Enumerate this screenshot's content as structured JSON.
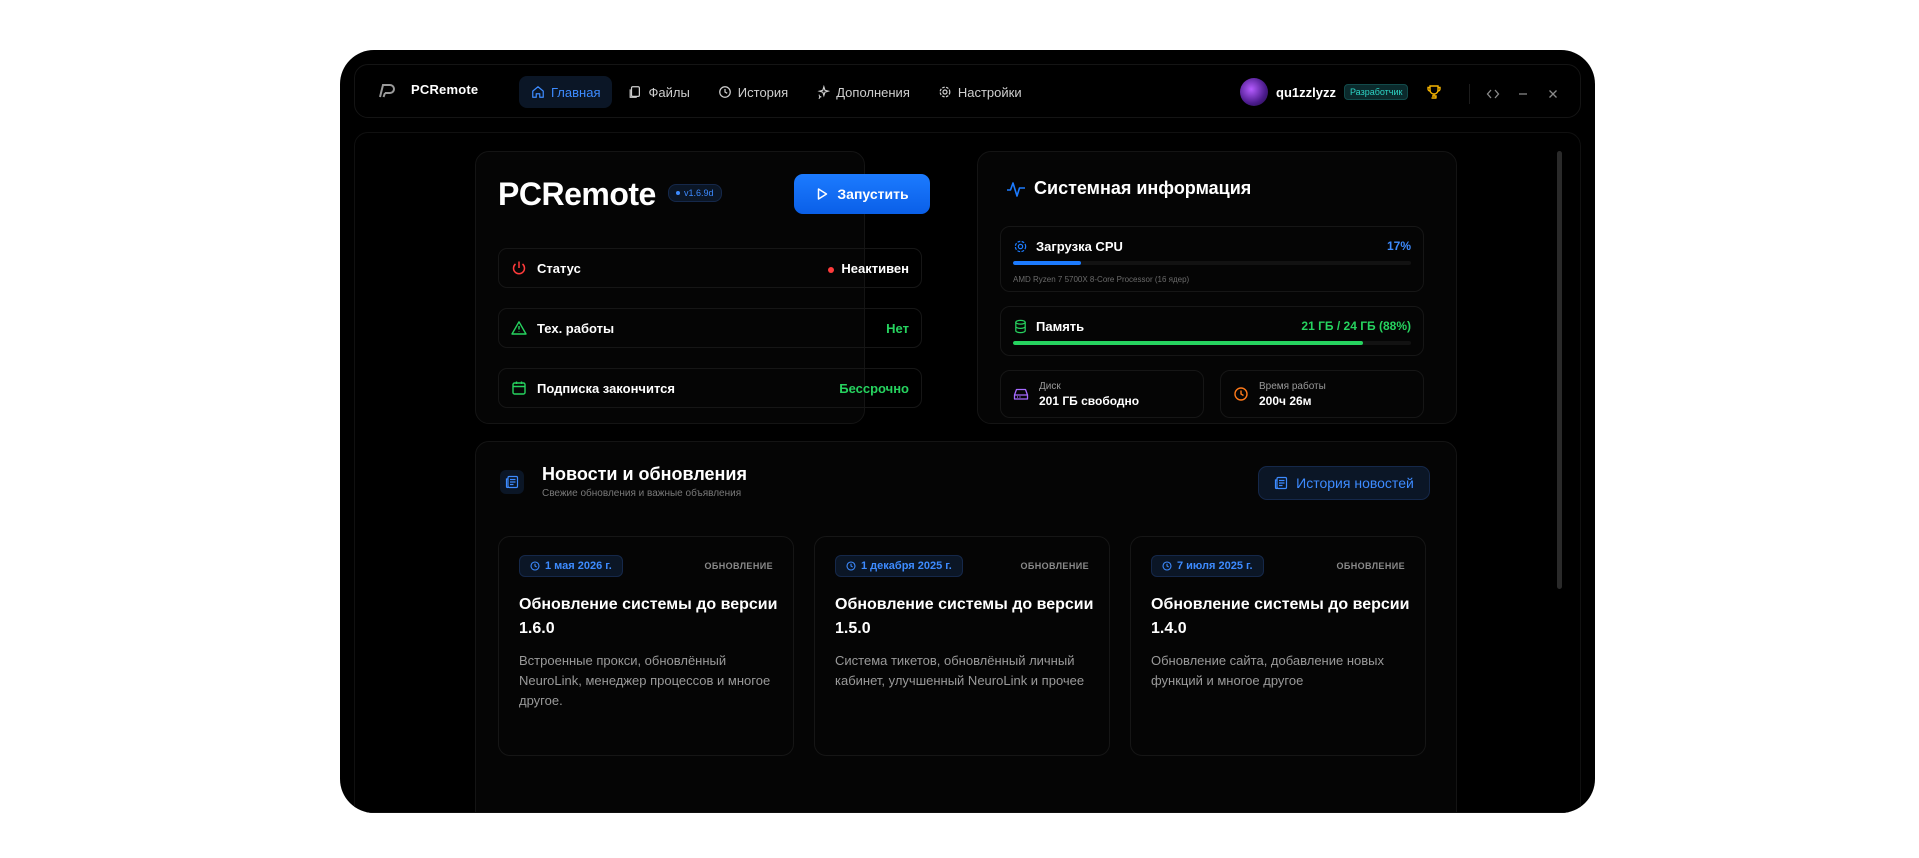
{
  "app": {
    "name": "PCRemote"
  },
  "nav": [
    {
      "label": "Главная",
      "icon": "home-icon",
      "active": true
    },
    {
      "label": "Файлы",
      "icon": "files-icon",
      "active": false
    },
    {
      "label": "История",
      "icon": "history-icon",
      "active": false
    },
    {
      "label": "Дополнения",
      "icon": "sparkles-icon",
      "active": false
    },
    {
      "label": "Настройки",
      "icon": "gear-icon",
      "active": false
    }
  ],
  "user": {
    "name": "qu1zzlyzz",
    "role": "Разработчик"
  },
  "hero": {
    "title": "PCRemote",
    "version": "v1.6.9d",
    "launch_label": "Запустить",
    "rows": [
      {
        "label": "Статус",
        "value": "Неактивен"
      },
      {
        "label": "Тех. работы",
        "value": "Нет"
      },
      {
        "label": "Подписка закончится",
        "value": "Бессрочно"
      }
    ]
  },
  "system": {
    "title": "Системная информация",
    "cpu": {
      "label": "Загрузка CPU",
      "value": "17%",
      "percent": 17,
      "model": "AMD Ryzen 7 5700X 8-Core Processor (16 ядер)"
    },
    "memory": {
      "label": "Память",
      "value": "21 ГБ / 24 ГБ (88%)",
      "percent": 88
    },
    "disk": {
      "label": "Диск",
      "value": "201 ГБ свободно"
    },
    "uptime": {
      "label": "Время работы",
      "value": "200ч 26м"
    }
  },
  "news": {
    "title": "Новости и обновления",
    "subtitle": "Свежие обновления и важные объявления",
    "history_label": "История новостей",
    "items": [
      {
        "date": "1 мая 2026 г.",
        "tag": "ОБНОВЛЕНИЕ",
        "title": "Обновление системы до версии 1.6.0",
        "desc": "Встроенные прокси, обновлённый NeuroLink, менеджер процессов и многое другое."
      },
      {
        "date": "1 декабря 2025 г.",
        "tag": "ОБНОВЛЕНИЕ",
        "title": "Обновление системы до версии 1.5.0",
        "desc": "Система тикетов, обновлённый личный кабинет, улучшенный NeuroLink и прочее"
      },
      {
        "date": "7 июля 2025 г.",
        "tag": "ОБНОВЛЕНИЕ",
        "title": "Обновление системы до версии 1.4.0",
        "desc": "Обновление сайта, добавление новых функций и многое другое"
      }
    ]
  },
  "colors": {
    "accent": "#1c7bff",
    "success": "#26d35f",
    "danger": "#ff3b3b",
    "warning": "#f5b400",
    "purple": "#a66bff",
    "orange": "#ff7a1a"
  }
}
